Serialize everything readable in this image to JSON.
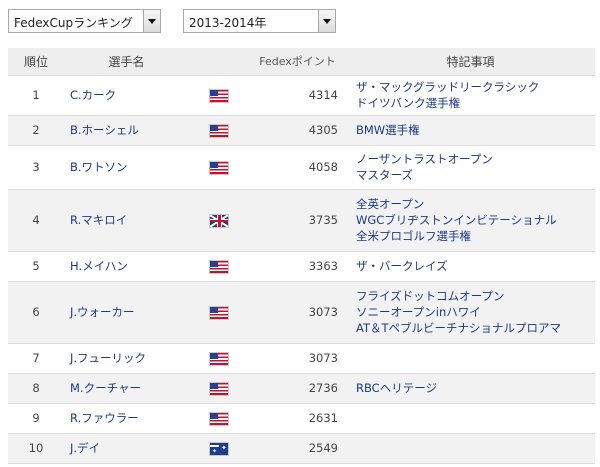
{
  "filters": {
    "ranking_type": "FedexCupランキング",
    "season": "2013-2014年"
  },
  "table": {
    "headers": {
      "rank": "順位",
      "player": "選手名",
      "points": "Fedexポイント",
      "notes": "特記事項"
    },
    "rows": [
      {
        "rank": "1",
        "player": "C.カーク",
        "flag": "us-flag-icon",
        "points": "4314",
        "notes": [
          "ザ・マックグラッドリークラシック",
          "ドイツバンク選手権"
        ]
      },
      {
        "rank": "2",
        "player": "B.ホーシェル",
        "flag": "us-flag-icon",
        "points": "4305",
        "notes": [
          "BMW選手権"
        ]
      },
      {
        "rank": "3",
        "player": "B.ワトソン",
        "flag": "us-flag-icon",
        "points": "4058",
        "notes": [
          "ノーザントラストオープン",
          "マスターズ"
        ]
      },
      {
        "rank": "4",
        "player": "R.マキロイ",
        "flag": "uk-flag-icon",
        "points": "3735",
        "notes": [
          "全英オープン",
          "WGCブリヂストンインビテーショナル",
          "全米プロゴルフ選手権"
        ]
      },
      {
        "rank": "5",
        "player": "H.メイハン",
        "flag": "us-flag-icon",
        "points": "3363",
        "notes": [
          "ザ・バークレイズ"
        ]
      },
      {
        "rank": "6",
        "player": "J.ウォーカー",
        "flag": "us-flag-icon",
        "points": "3073",
        "notes": [
          "フライズドットコムオープン",
          "ソニーオープンinハワイ",
          "AT＆Tペブルビーチナショナルプロアマ"
        ]
      },
      {
        "rank": "7",
        "player": "J.フューリック",
        "flag": "us-flag-icon",
        "points": "3073",
        "notes": []
      },
      {
        "rank": "8",
        "player": "M.クーチャー",
        "flag": "us-flag-icon",
        "points": "2736",
        "notes": [
          "RBCヘリテージ"
        ]
      },
      {
        "rank": "9",
        "player": "R.ファウラー",
        "flag": "us-flag-icon",
        "points": "2631",
        "notes": []
      },
      {
        "rank": "10",
        "player": "J.デイ",
        "flag": "au-flag-icon",
        "points": "2549",
        "notes": []
      }
    ]
  }
}
